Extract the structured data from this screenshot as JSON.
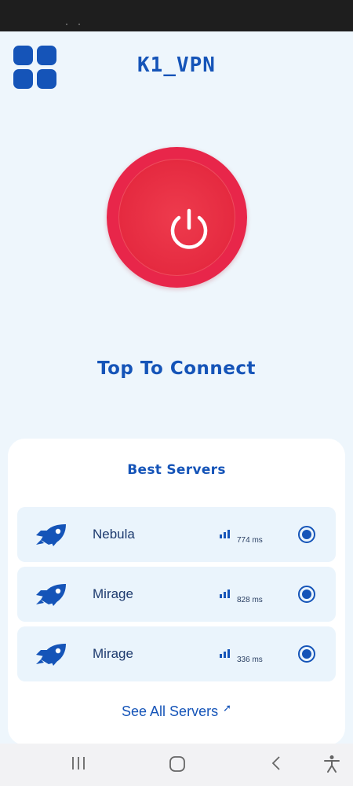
{
  "app": {
    "title": "K1_VPN"
  },
  "power": {
    "label": "Top To Connect"
  },
  "servers": {
    "heading": "Best Servers",
    "items": [
      {
        "name": "Nebula",
        "ping": "774 ms"
      },
      {
        "name": "Mirage",
        "ping": "828 ms"
      },
      {
        "name": "Mirage",
        "ping": "336 ms"
      }
    ],
    "see_all": "See All Servers"
  },
  "icons": {
    "menu": "grid-icon",
    "power": "power-icon",
    "server": "rocket-icon",
    "signal": "signal-icon",
    "select": "radio-icon",
    "arrow": "arrow-up-right-icon",
    "nav": [
      "recent-apps-icon",
      "home-icon",
      "back-icon",
      "accessibility-icon"
    ]
  },
  "colors": {
    "accent": "#1554b8",
    "power": "#e8264a",
    "background": "#eef6fc",
    "card": "#ffffff",
    "row": "#eaf4fc"
  }
}
